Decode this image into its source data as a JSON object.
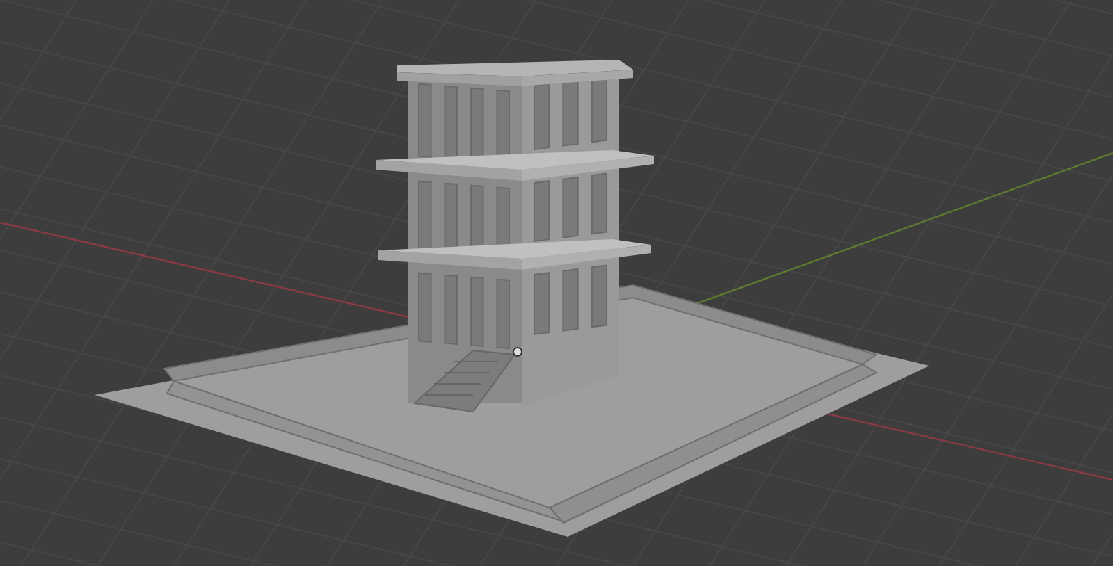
{
  "viewport": {
    "kind": "scene"
  }
}
